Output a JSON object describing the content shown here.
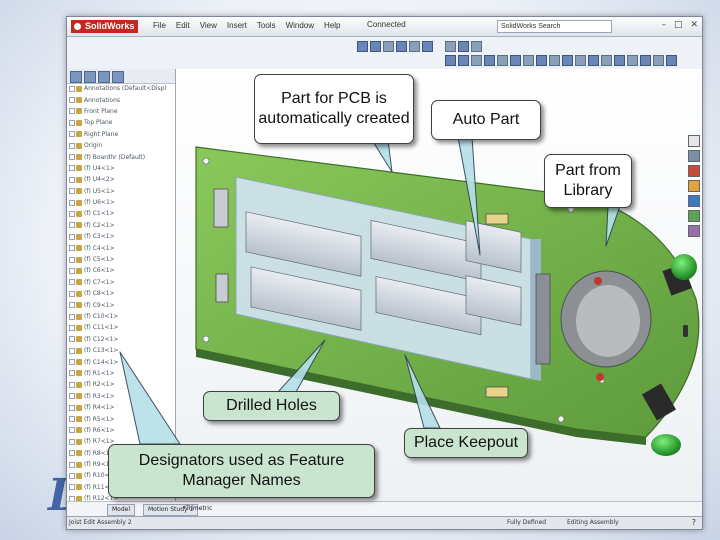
{
  "app": {
    "name": "SolidWorks",
    "menu": [
      "File",
      "Edit",
      "View",
      "Insert",
      "Tools",
      "Window",
      "Help"
    ],
    "title_tools": "Connected",
    "search_placeholder": "SolidWorks Search"
  },
  "feature_tree": {
    "items": [
      "Annotations (Default<Displ",
      "Annotations",
      "Front Plane",
      "Top Plane",
      "Right Plane",
      "Origin",
      "(f) Boardhr (Default)",
      "(f) U4<1>",
      "(f) U4<2>",
      "(f) U5<1>",
      "(f) U6<1>",
      "(f) C1<1>",
      "(f) C2<1>",
      "(f) C3<1>",
      "(f) C4<1>",
      "(f) C5<1>",
      "(f) C6<1>",
      "(f) C7<1>",
      "(f) C8<1>",
      "(f) C9<1>",
      "(f) C10<1>",
      "(f) C11<1>",
      "(f) C12<1>",
      "(f) C13<1>",
      "(f) C14<1>",
      "(f) R1<1>",
      "(f) R2<1>",
      "(f) R3<1>",
      "(f) R4<1>",
      "(f) R5<1>",
      "(f) R6<1>",
      "(f) R7<1>",
      "(f) R8<1>",
      "(f) R9<1>",
      "(f) R10<1>",
      "(f) R11<1>",
      "(f) R12<1>"
    ]
  },
  "sheet_tabs": [
    "Model",
    "Motion Study 1"
  ],
  "viewport_label": "*Trimetric",
  "status": {
    "left": "Joist Edit Assembly 2",
    "right_1": "Fully Defined",
    "right_2": "Editing Assembly"
  },
  "callouts": {
    "pcb_part": "Part for PCB is automatically created",
    "auto_part": "Auto Part",
    "library_part": "Part from Library",
    "drilled_holes": "Drilled Holes",
    "place_keepout": "Place Keepout",
    "designators": "Designators used as Feature Manager Names"
  },
  "colors": {
    "pcb_board": "#7ab84e",
    "callout_fill": "#ffffff",
    "callout_fill_alt": "#c9e5cf",
    "leader_fill": "#b5dfe8"
  }
}
